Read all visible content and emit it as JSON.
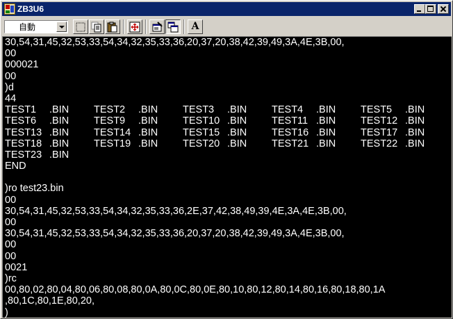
{
  "window": {
    "title": "ZB3U6"
  },
  "toolbar": {
    "mode_select_value": "自動",
    "font_button_glyph": "A"
  },
  "console": {
    "lines": [
      "30,54,31,45,32,53,33,54,34,32,35,33,36,20,37,20,38,42,39,49,3A,4E,3B,00,",
      "00",
      "000021",
      "00",
      ")d",
      "44"
    ],
    "directory": [
      [
        {
          "name": "TEST1",
          "ext": ".BIN"
        },
        {
          "name": "TEST2",
          "ext": ".BIN"
        },
        {
          "name": "TEST3",
          "ext": ".BIN"
        },
        {
          "name": "TEST4",
          "ext": ".BIN"
        },
        {
          "name": "TEST5",
          "ext": ".BIN"
        }
      ],
      [
        {
          "name": "TEST6",
          "ext": ".BIN"
        },
        {
          "name": "TEST9",
          "ext": ".BIN"
        },
        {
          "name": "TEST10",
          "ext": ".BIN"
        },
        {
          "name": "TEST11",
          "ext": ".BIN"
        },
        {
          "name": "TEST12",
          "ext": ".BIN"
        }
      ],
      [
        {
          "name": "TEST13",
          "ext": ".BIN"
        },
        {
          "name": "TEST14",
          "ext": ".BIN"
        },
        {
          "name": "TEST15",
          "ext": ".BIN"
        },
        {
          "name": "TEST16",
          "ext": ".BIN"
        },
        {
          "name": "TEST17",
          "ext": ".BIN"
        }
      ],
      [
        {
          "name": "TEST18",
          "ext": ".BIN"
        },
        {
          "name": "TEST19",
          "ext": ".BIN"
        },
        {
          "name": "TEST20",
          "ext": ".BIN"
        },
        {
          "name": "TEST21",
          "ext": ".BIN"
        },
        {
          "name": "TEST22",
          "ext": ".BIN"
        }
      ],
      [
        {
          "name": "TEST23",
          "ext": ".BIN"
        }
      ]
    ],
    "lines_after": [
      "END",
      "",
      ")ro test23.bin",
      "00",
      "30,54,31,45,32,53,33,54,34,32,35,33,36,2E,37,42,38,49,39,4E,3A,4E,3B,00,",
      "00",
      "30,54,31,45,32,53,33,54,34,32,35,33,36,20,37,20,38,42,39,49,3A,4E,3B,00,",
      "00",
      "00",
      "0021",
      ")rc",
      "00,80,02,80,04,80,06,80,08,80,0A,80,0C,80,0E,80,10,80,12,80,14,80,16,80,18,80,1A",
      ",80,1C,80,1E,80,20,",
      ")"
    ]
  }
}
